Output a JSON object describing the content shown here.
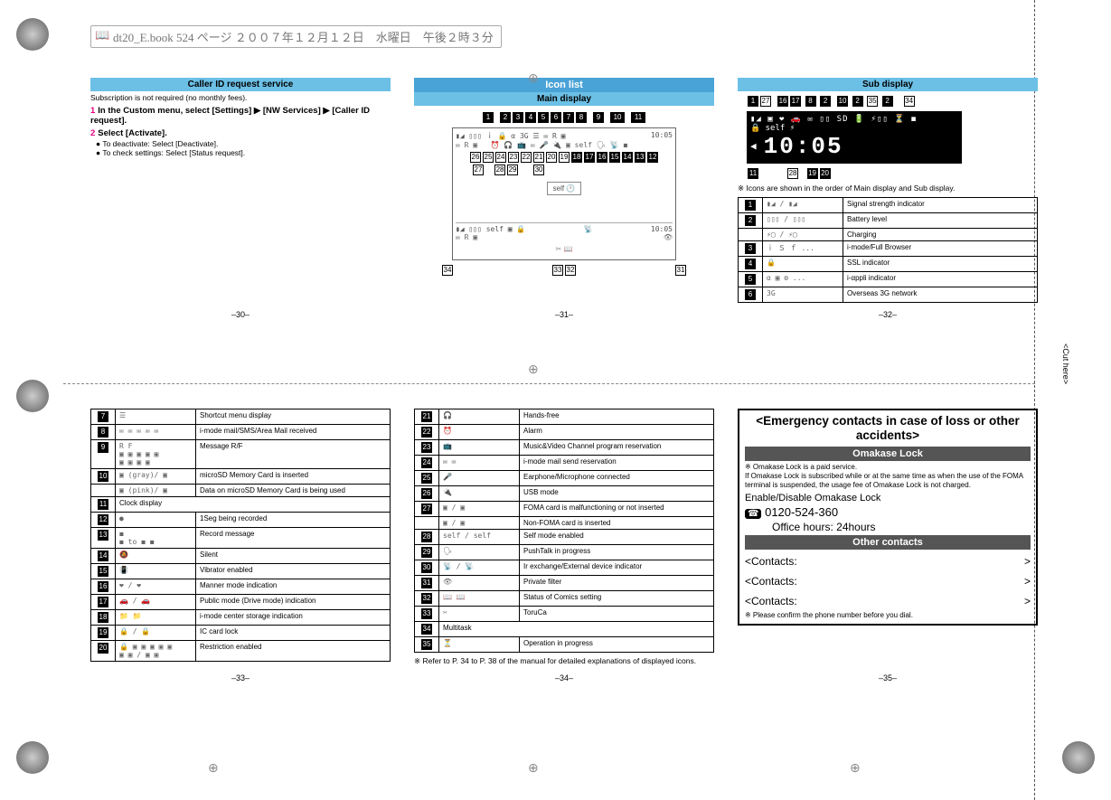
{
  "header_line": "dt20_E.book  524 ページ  ２００７年１２月１２日　水曜日　午後２時３分",
  "cut_here": "<Cut here>",
  "p30": {
    "title": "Caller ID request service",
    "note": "Subscription is not required (no monthly fees).",
    "step1": "In the Custom menu, select [Settings] ▶ [NW Services] ▶ [Caller ID request].",
    "step2": "Select [Activate].",
    "b1": "To deactivate: Select [Deactivate].",
    "b2": "To check settings: Select [Status request].",
    "page": "–30–"
  },
  "p31": {
    "title": "Icon list",
    "sub": "Main display",
    "time": "10:05",
    "nums_top": [
      "1",
      "2",
      "3",
      "4",
      "5",
      "6",
      "7",
      "8",
      "9",
      "10",
      "11"
    ],
    "nums_mid": [
      "26",
      "25",
      "24",
      "23",
      "22",
      "21",
      "20",
      "19",
      "18",
      "17",
      "16",
      "15",
      "14",
      "13",
      "12"
    ],
    "nums_low": [
      "27",
      "28",
      "29",
      "30"
    ],
    "nums_bottom": [
      "34",
      "33",
      "32",
      "31"
    ],
    "page": "–31–"
  },
  "p32": {
    "title": "Sub display",
    "nums": [
      "1",
      "27",
      "16",
      "17",
      "8",
      "2",
      "10",
      "2",
      "35",
      "2",
      "34",
      "11",
      "28",
      "19",
      "20"
    ],
    "time": "10:05",
    "note": "※ Icons are shown in the order of Main display and Sub display.",
    "rows": [
      {
        "n": "1",
        "sym": "▮◢ / ▮◢",
        "desc": "Signal strength indicator"
      },
      {
        "n": "2",
        "sym": "▯▯▯ / ▯▯▯",
        "desc": "Battery level"
      },
      {
        "n": "",
        "sym": "⚡▢ / ⚡▢",
        "desc": "Charging"
      },
      {
        "n": "3",
        "sym": "ｉ Ｓ ｆ ...",
        "desc": "i-mode/Full Browser"
      },
      {
        "n": "4",
        "sym": "🔒",
        "desc": "SSL indicator"
      },
      {
        "n": "5",
        "sym": "α ▣ ⚙ ...",
        "desc": "i-αppli indicator"
      },
      {
        "n": "6",
        "sym": "3G",
        "desc": "Overseas 3G network"
      }
    ],
    "page": "–32–"
  },
  "p33": {
    "rows": [
      {
        "n": "7",
        "sym": "☰",
        "desc": "Shortcut menu display"
      },
      {
        "n": "8",
        "sym": "✉ ✉ ✉ ✉ ✉",
        "desc": "i-mode mail/SMS/Area Mail received"
      },
      {
        "n": "9",
        "sym": "R F\n▣ ▣ ▣ ▣ ▣\n▣ ▣ ▣ ▣",
        "desc": "Message R/F"
      },
      {
        "n": "10",
        "sym": "▣ (gray)/ ▣",
        "desc": "microSD Memory Card is inserted"
      },
      {
        "n": "",
        "sym": "▣ (pink)/ ▣",
        "desc": "Data on microSD Memory Card is being used"
      },
      {
        "n": "11",
        "sym": "Clock display",
        "desc": ""
      },
      {
        "n": "12",
        "sym": "●",
        "desc": "1Seg being recorded"
      },
      {
        "n": "13",
        "sym": "◼\n◼ to ◼ ◼",
        "desc": "Record message"
      },
      {
        "n": "14",
        "sym": "🔕",
        "desc": "Silent"
      },
      {
        "n": "15",
        "sym": "📳",
        "desc": "Vibrator enabled"
      },
      {
        "n": "16",
        "sym": "❤ / ❤",
        "desc": "Manner mode indication"
      },
      {
        "n": "17",
        "sym": "🚗 / 🚗",
        "desc": "Public mode (Drive mode) indication"
      },
      {
        "n": "18",
        "sym": "📁 📁",
        "desc": "i-mode center storage indication"
      },
      {
        "n": "19",
        "sym": "🔒 / 🔒",
        "desc": "IC card lock"
      },
      {
        "n": "20",
        "sym": "🔒 ▣ ▣ ▣ ▣ ▣\n▣ ▣ / ▣ ▣",
        "desc": "Restriction enabled"
      }
    ],
    "page": "–33–"
  },
  "p34": {
    "rows": [
      {
        "n": "21",
        "sym": "🎧",
        "desc": "Hands-free"
      },
      {
        "n": "22",
        "sym": "⏰",
        "desc": "Alarm"
      },
      {
        "n": "23",
        "sym": "📺",
        "desc": "Music&Video Channel program reservation"
      },
      {
        "n": "24",
        "sym": "✉ ✉",
        "desc": "i-mode mail send reservation"
      },
      {
        "n": "25",
        "sym": "🎤",
        "desc": "Earphone/Microphone connected"
      },
      {
        "n": "26",
        "sym": "🔌",
        "desc": "USB mode"
      },
      {
        "n": "27",
        "sym": "▣ / ▣",
        "desc": "FOMA card is malfunctioning or not inserted"
      },
      {
        "n": "",
        "sym": "▣ / ▣",
        "desc": "Non-FOMA card is inserted"
      },
      {
        "n": "28",
        "sym": "self / self",
        "desc": "Self mode enabled"
      },
      {
        "n": "29",
        "sym": "🗣",
        "desc": "PushTalk in progress"
      },
      {
        "n": "30",
        "sym": "📡 / 📡",
        "desc": "Ir exchange/External device indicator"
      },
      {
        "n": "31",
        "sym": "👁",
        "desc": "Private filter"
      },
      {
        "n": "32",
        "sym": "📖 📖",
        "desc": "Status of Comics setting"
      },
      {
        "n": "33",
        "sym": "✂",
        "desc": "ToruCa"
      },
      {
        "n": "34",
        "sym": "Multitask",
        "desc": ""
      },
      {
        "n": "35",
        "sym": "⏳",
        "desc": "Operation in progress"
      }
    ],
    "foot": "※ Refer to P. 34 to P. 38 of the manual for detailed explanations of displayed icons.",
    "page": "–34–"
  },
  "p35": {
    "title": "<Emergency contacts in case of loss or other accidents>",
    "bar1": "Omakase Lock",
    "note1": "※ Omakase Lock is a paid service.\nIf Omakase Lock is subscribed while or at the same time as when the use of the FOMA terminal is suspended, the usage fee of Omakase Lock is not charged.",
    "enable": "Enable/Disable Omakase Lock",
    "tel_icon": "☎",
    "tel": "0120-524-360",
    "hours": "Office hours: 24hours",
    "bar2": "Other contacts",
    "c_lbl": "<Contacts:",
    "c_end": ">",
    "foot": "※ Please confirm the phone number before you dial.",
    "page": "–35–"
  }
}
